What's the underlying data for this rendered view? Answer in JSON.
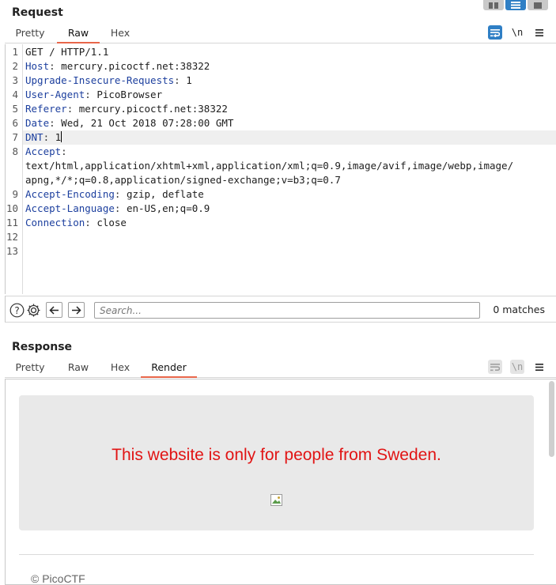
{
  "request": {
    "title": "Request",
    "tabs": [
      "Pretty",
      "Raw",
      "Hex"
    ],
    "active_tab": "Raw",
    "newline_icon_label": "\\n",
    "lines": [
      {
        "num": "1",
        "name": "",
        "sep": "",
        "value": "GET / HTTP/1.1"
      },
      {
        "num": "2",
        "name": "Host",
        "sep": ": ",
        "value": "mercury.picoctf.net:38322"
      },
      {
        "num": "3",
        "name": "Upgrade-Insecure-Requests",
        "sep": ": ",
        "value": "1"
      },
      {
        "num": "4",
        "name": "User-Agent",
        "sep": ": ",
        "value": "PicoBrowser"
      },
      {
        "num": "5",
        "name": "Referer",
        "sep": ": ",
        "value": "mercury.picoctf.net:38322"
      },
      {
        "num": "6",
        "name": "Date",
        "sep": ": ",
        "value": "Wed, 21 Oct 2018 07:28:00 GMT"
      },
      {
        "num": "7",
        "name": "DNT",
        "sep": ": ",
        "value": "1"
      },
      {
        "num": "8",
        "name": "Accept",
        "sep": ":",
        "value": ""
      },
      {
        "num": "",
        "name": "",
        "sep": "",
        "value": "text/html,application/xhtml+xml,application/xml;q=0.9,image/avif,image/webp,image/"
      },
      {
        "num": "",
        "name": "",
        "sep": "",
        "value": "apng,*/*;q=0.8,application/signed-exchange;v=b3;q=0.7"
      },
      {
        "num": "9",
        "name": "Accept-Encoding",
        "sep": ": ",
        "value": "gzip, deflate"
      },
      {
        "num": "10",
        "name": "Accept-Language",
        "sep": ": ",
        "value": "en-US,en;q=0.9"
      },
      {
        "num": "11",
        "name": "Connection",
        "sep": ": ",
        "value": "close"
      },
      {
        "num": "12",
        "name": "",
        "sep": "",
        "value": ""
      },
      {
        "num": "13",
        "name": "",
        "sep": "",
        "value": ""
      }
    ]
  },
  "search": {
    "placeholder": "Search...",
    "value": "",
    "matches": "0 matches"
  },
  "response": {
    "title": "Response",
    "tabs": [
      "Pretty",
      "Raw",
      "Hex",
      "Render"
    ],
    "active_tab": "Render",
    "newline_icon_label": "\\n",
    "page": {
      "message": "This website is only for people from Sweden.",
      "footer": "© PicoCTF"
    }
  }
}
